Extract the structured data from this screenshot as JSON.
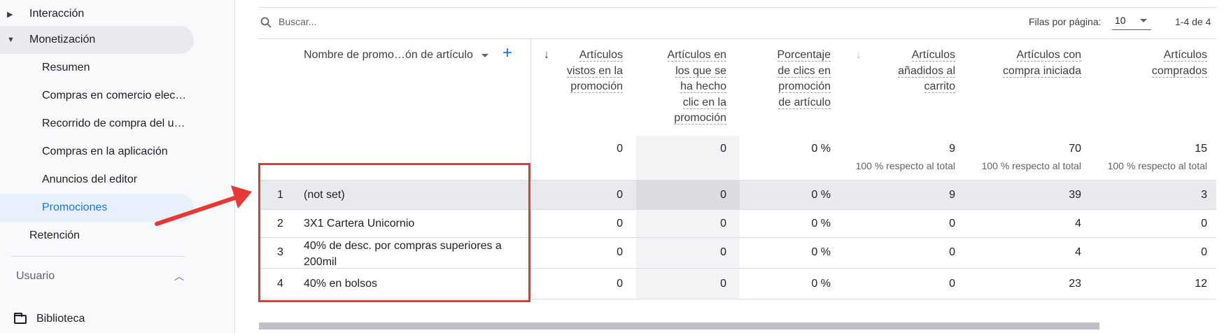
{
  "sidebar": {
    "interaccion": "Interacción",
    "monetizacion": "Monetización",
    "sub": [
      "Resumen",
      "Compras en comercio elec…",
      "Recorrido de compra del u…",
      "Compras en la aplicación",
      "Anuncios del editor",
      "Promociones"
    ],
    "retencion": "Retención",
    "usuario": "Usuario",
    "biblioteca": "Biblioteca"
  },
  "toolbar": {
    "search_placeholder": "Buscar...",
    "rows_label": "Filas por página:",
    "rows_value": "10",
    "range": "1-4 de 4"
  },
  "table": {
    "dimension_header": "Nombre de promo…ón de artículo",
    "metric_headers": [
      [
        "Artículos",
        "vistos en la",
        "promoción"
      ],
      [
        "Artículos en",
        "los que se",
        "ha hecho",
        "clic en la",
        "promoción"
      ],
      [
        "Porcentaje",
        "de clics en",
        "promoción",
        "de artículo"
      ],
      [
        "Artículos",
        "añadidos al",
        "carrito"
      ],
      [
        "Artículos con",
        "compra iniciada"
      ],
      [
        "Artículos",
        "comprados"
      ]
    ],
    "totals": [
      "0",
      "0",
      "0 %",
      "9",
      "70",
      "15"
    ],
    "totals_sub": [
      "",
      "",
      "",
      "100 % respecto al total",
      "100 % respecto al total",
      "100 % respecto al total"
    ],
    "rows": [
      {
        "idx": "1",
        "name": "(not set)",
        "vals": [
          "0",
          "0",
          "0 %",
          "9",
          "39",
          "3"
        ]
      },
      {
        "idx": "2",
        "name": "3X1 Cartera Unicornio",
        "vals": [
          "0",
          "0",
          "0 %",
          "0",
          "4",
          "0"
        ]
      },
      {
        "idx": "3",
        "name_l1": "40% de desc. por compras superiores a",
        "name_l2": "200mil",
        "vals": [
          "0",
          "0",
          "0 %",
          "0",
          "4",
          "0"
        ]
      },
      {
        "idx": "4",
        "name": "40% en bolsos",
        "vals": [
          "0",
          "0",
          "0 %",
          "0",
          "23",
          "12"
        ]
      }
    ]
  },
  "colors": {
    "accent": "#1a73e8",
    "annotation": "#e53935"
  }
}
